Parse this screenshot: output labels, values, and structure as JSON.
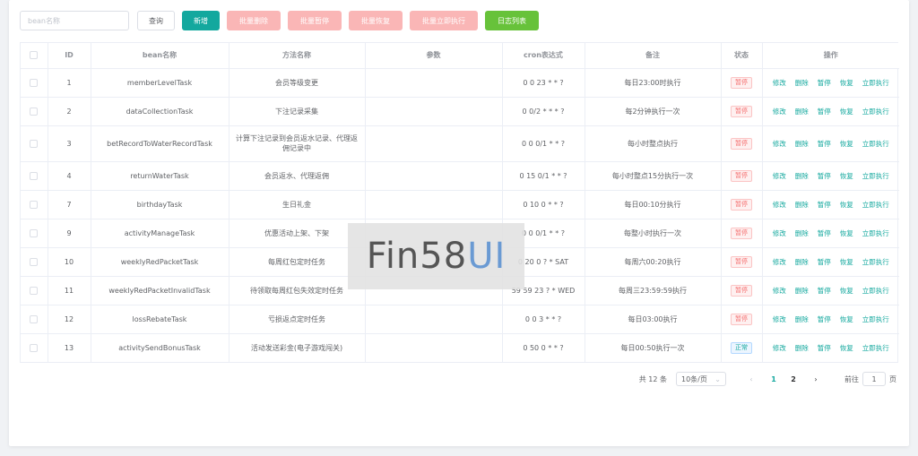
{
  "toolbar": {
    "search_placeholder": "bean名称",
    "query": "查询",
    "add": "新增",
    "batch_delete": "批量删除",
    "batch_pause": "批量暂停",
    "batch_resume": "批量恢复",
    "batch_run": "批量立即执行",
    "log_list": "日志列表"
  },
  "table": {
    "headers": [
      "ID",
      "bean名称",
      "方法名称",
      "参数",
      "cron表达式",
      "备注",
      "状态",
      "操作"
    ],
    "ops": [
      "修改",
      "删除",
      "暂停",
      "恢复",
      "立即执行"
    ],
    "rows": [
      {
        "id": "1",
        "bean": "memberLevelTask",
        "method": "会员等级变更",
        "params": "",
        "cron": "0 0 23 * * ?",
        "remark": "每日23:00时执行",
        "status": "暂停"
      },
      {
        "id": "2",
        "bean": "dataCollectionTask",
        "method": "下注记录采集",
        "params": "",
        "cron": "0 0/2 * * * ?",
        "remark": "每2分钟执行一次",
        "status": "暂停"
      },
      {
        "id": "3",
        "bean": "betRecordToWaterRecordTask",
        "method": "计算下注记录到会员返水记录、代理返佣记录中",
        "params": "",
        "cron": "0 0 0/1 * * ?",
        "remark": "每小时整点执行",
        "status": "暂停"
      },
      {
        "id": "4",
        "bean": "returnWaterTask",
        "method": "会员返水、代理返佣",
        "params": "",
        "cron": "0 15 0/1 * * ?",
        "remark": "每小时整点15分执行一次",
        "status": "暂停"
      },
      {
        "id": "7",
        "bean": "birthdayTask",
        "method": "生日礼金",
        "params": "",
        "cron": "0 10 0 * * ?",
        "remark": "每日00:10分执行",
        "status": "暂停"
      },
      {
        "id": "9",
        "bean": "activityManageTask",
        "method": "优惠活动上架、下架",
        "params": "",
        "cron": "0 0 0/1 * * ?",
        "remark": "每整小时执行一次",
        "status": "暂停"
      },
      {
        "id": "10",
        "bean": "weeklyRedPacketTask",
        "method": "每周红包定时任务",
        "params": "",
        "cron": "0 20 0 ? * SAT",
        "remark": "每周六00:20执行",
        "status": "暂停"
      },
      {
        "id": "11",
        "bean": "weeklyRedPacketInvalidTask",
        "method": "待领取每周红包失效定时任务",
        "params": "",
        "cron": "59 59 23 ? * WED",
        "remark": "每周三23:59:59执行",
        "status": "暂停"
      },
      {
        "id": "12",
        "bean": "lossRebateTask",
        "method": "亏损返点定时任务",
        "params": "",
        "cron": "0 0 3 * * ?",
        "remark": "每日03:00执行",
        "status": "暂停"
      },
      {
        "id": "13",
        "bean": "activitySendBonusTask",
        "method": "活动发送彩金(电子游戏闯关)",
        "params": "",
        "cron": "0 50 0 * * ?",
        "remark": "每日00:50执行一次",
        "status": "正常"
      }
    ]
  },
  "pager": {
    "total": "共 12 条",
    "page_size": "10条/页",
    "pages": [
      "1",
      "2"
    ],
    "goto_prefix": "前往",
    "goto_value": "1",
    "goto_suffix": "页"
  },
  "watermark": {
    "part1": "Fin58",
    "part2": "UI"
  },
  "colors": {
    "primary": "#13a89e",
    "danger_light": "#fab6b6",
    "success": "#67c23a",
    "danger": "#f56c6c"
  }
}
